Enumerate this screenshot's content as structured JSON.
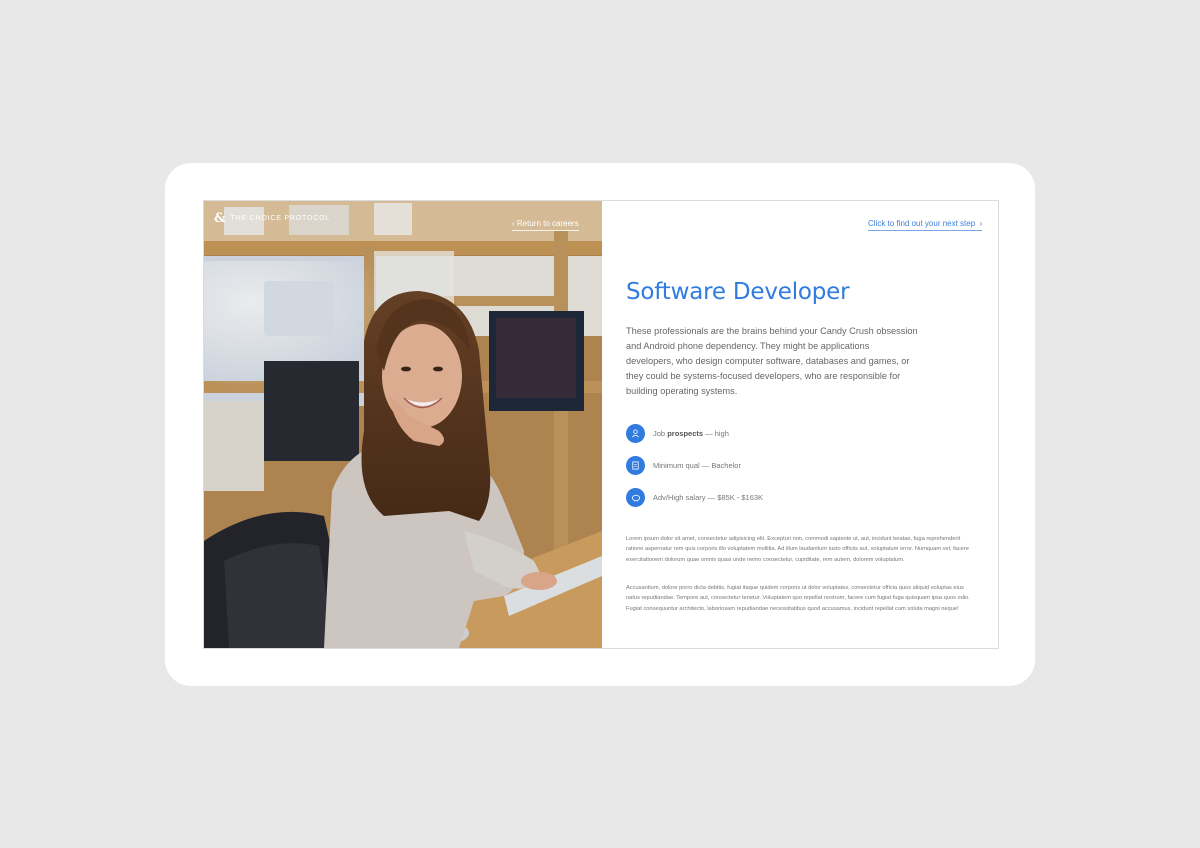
{
  "brand": {
    "logo_mark": "&",
    "name": "THE CHOICE PROTOCOL"
  },
  "nav": {
    "return_label": "Return to careers",
    "next_label": "Click to find out your next step"
  },
  "career": {
    "title": "Software Developer",
    "description": "These professionals are the brains behind your Candy Crush obsession and Android phone dependency. They might be applications developers, who design computer software, databases and games, or they could be systems-focused developers, who are responsible for building operating systems."
  },
  "facts": [
    {
      "icon": "person-icon",
      "label_prefix": "Job ",
      "label_bold": "prospects",
      "label_suffix": " — high"
    },
    {
      "icon": "document-icon",
      "label_prefix": "Minimum qual — Bachelor",
      "label_bold": "",
      "label_suffix": ""
    },
    {
      "icon": "piggy-bank-icon",
      "label_prefix": "Adv/High salary — $85K - $163K",
      "label_bold": "",
      "label_suffix": ""
    }
  ],
  "body_text": [
    "Lorem ipsum dolor sit amet, consectetur adipisicing elit. Excepturi non, commodi sapiente ut, aut, incidunt beatae, fuga reprehenderit ratione aspernatur rem quis corporis illo voluptatem mollitia. Ad illum laudantium iusto officiis aut, voluptatum error. Numquam vel, facere exercitationem dolorum quae omnis quasi unde nemo consectetur, cupiditate, rem autem, dolorem voluptatum.",
    "Accusantium, dolore porro dicta debitis, fugiat itaque quidem corporis ut dolor voluptates, consectetur officia quos aliquid voluptas eius natus repudiandae. Tempore aut, consectetur tenetur. Voluptatem quo repellat nostrum, facere cum fugiat fuga quisquam ipsa quos odio. Fugiat consequuntur architecto, laboriosam repudiandae necessitatibus quod accusamus, incidunt repellat cum soluta magni neque!"
  ],
  "colors": {
    "accent": "#2f7be0",
    "background": "#e8e8e8",
    "device": "#ffffff"
  }
}
